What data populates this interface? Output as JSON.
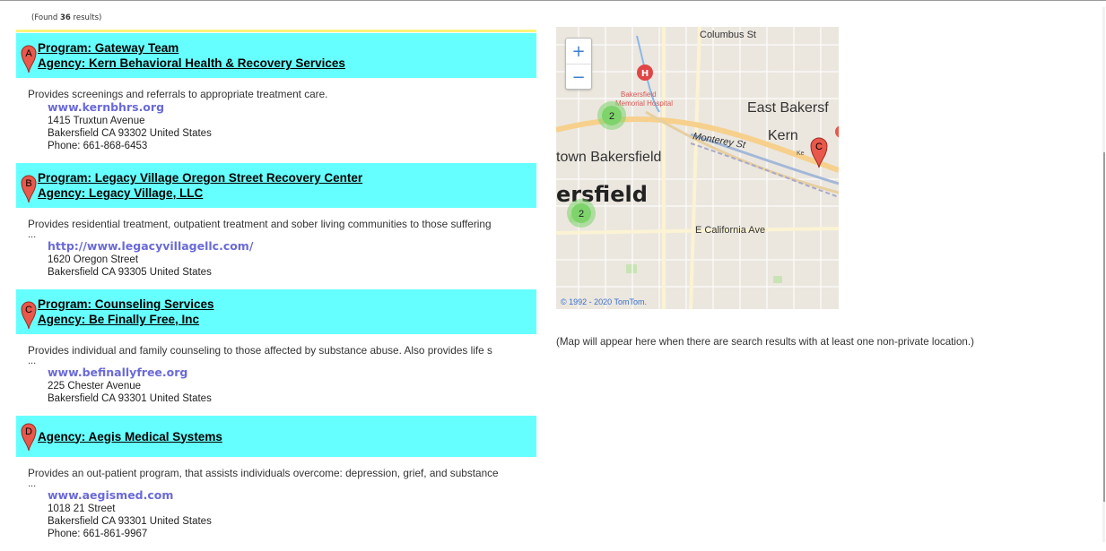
{
  "results_summary": {
    "prefix": "(Found ",
    "count": "36",
    "suffix": " results)"
  },
  "results": [
    {
      "marker": "A",
      "program": "Program: Gateway Team",
      "agency": "Agency: Kern Behavioral Health & Recovery Services",
      "description": "Provides screenings and referrals to appropriate treatment care.",
      "ellipsis": "",
      "url": "www.kernbhrs.org",
      "street": "1415 Truxtun Avenue",
      "city": "Bakersfield CA 93302 United States",
      "phone": "Phone: 661-868-6453"
    },
    {
      "marker": "B",
      "program": "Program: Legacy Village Oregon Street Recovery Center",
      "agency": "Agency: Legacy Village, LLC",
      "description": "Provides residential treatment, outpatient treatment and sober living communities to those suffering",
      "ellipsis": "...",
      "url": "http://www.legacyvillagellc.com/",
      "street": "1620 Oregon Street",
      "city": "Bakersfield CA 93305 United States",
      "phone": ""
    },
    {
      "marker": "C",
      "program": "Program: Counseling Services",
      "agency": "Agency: Be Finally Free, Inc",
      "description": "Provides individual and family counseling to those affected by substance abuse. Also provides life s",
      "ellipsis": "...",
      "url": "www.befinallyfree.org",
      "street": "225 Chester Avenue",
      "city": "Bakersfield CA 93301 United States",
      "phone": ""
    },
    {
      "marker": "D",
      "program": "",
      "agency": "Agency: Aegis Medical Systems",
      "description": "Provides an out-patient program, that assists individuals overcome: depression, grief, and substance",
      "ellipsis": "...",
      "url": "www.aegismed.com",
      "street": "1018 21 Street",
      "city": "Bakersfield CA 93301 United States",
      "phone": "Phone: 661-861-9967"
    }
  ],
  "map": {
    "zoom_in": "+",
    "zoom_out": "−",
    "labels": {
      "columbus": "Columbus St",
      "east_bakersfield": "East Bakersf",
      "kern": "Kern",
      "monterey": "Monterey St",
      "downtown": "town Bakersfield",
      "bakersfield_big": "ersfield",
      "california": "E California Ave",
      "hospital_1": "Bakersfield",
      "hospital_2": "Memorial Hospital",
      "kern_small": "Ke"
    },
    "hospital_icon": "H",
    "cluster_1": "2",
    "cluster_2": "2",
    "marker_c": "C",
    "copyright": "© 1992 - 2020 TomTom.",
    "colors": {
      "cluster": "#7ed36b",
      "hospital": "#e04646",
      "marker": "#e8584b"
    }
  },
  "map_note": "(Map will appear here when there are search results with at least one non-private location.)",
  "colors": {
    "result_header_bg": "#66ffff",
    "url": "#6a6ad8",
    "divider": "#fff27a"
  }
}
